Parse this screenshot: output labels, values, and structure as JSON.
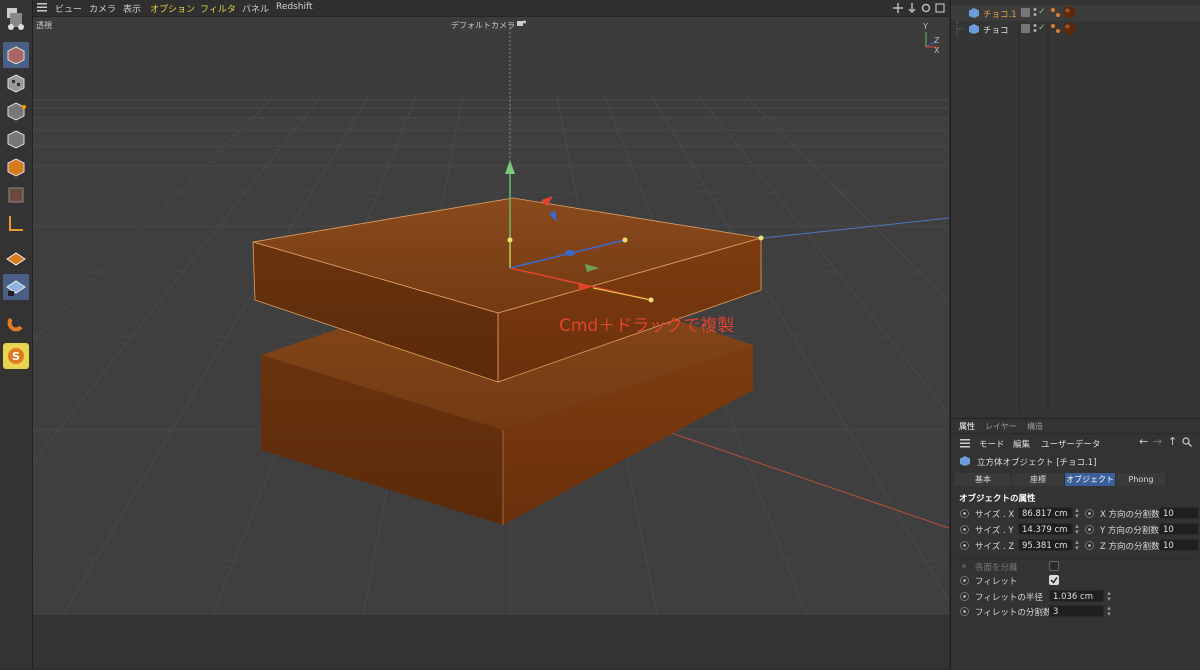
{
  "menubar": {
    "items": [
      "ビュー",
      "カメラ",
      "表示",
      "オプション",
      "フィルタ",
      "パネル",
      "Redshift"
    ]
  },
  "viewport": {
    "view_label": "透視",
    "camera_label": "デフォルトカメラ",
    "annotation": "Cmd＋ドラッグで複製",
    "axis_letters": {
      "y": "Y",
      "z": "Z",
      "x": "X"
    }
  },
  "object_manager": {
    "objects": [
      {
        "name": "チョコ.1",
        "selected": true
      },
      {
        "name": "チョコ",
        "selected": false
      }
    ]
  },
  "attributes": {
    "tabs": [
      "属性",
      "レイヤー",
      "構造"
    ],
    "toolbar": [
      "モード",
      "編集",
      "ユーザーデータ"
    ],
    "object_title": "立方体オブジェクト [チョコ.1]",
    "subtabs": [
      "基本",
      "座標",
      "オブジェクト",
      "Phong"
    ],
    "active_subtab": "オブジェクト",
    "section_title": "オブジェクトの属性",
    "size_rows": [
      {
        "label": "サイズ . X",
        "value": "86.817 cm",
        "seg_label": "X 方向の分割数",
        "seg_value": "10"
      },
      {
        "label": "サイズ . Y",
        "value": "14.379 cm",
        "seg_label": "Y 方向の分割数",
        "seg_value": "10"
      },
      {
        "label": "サイズ . Z",
        "value": "95.381 cm",
        "seg_label": "Z 方向の分割数",
        "seg_value": "10"
      }
    ],
    "separate_faces_label": "各面を分離",
    "fillet_label": "フィレット",
    "fillet_checked": true,
    "fillet_radius_label": "フィレットの半径",
    "fillet_radius_value": "1.036 cm",
    "fillet_subdiv_label": "フィレットの分割数",
    "fillet_subdiv_value": "3"
  },
  "colors": {
    "accent_blue": "#3a5f99",
    "chocolate": "#7a3a10",
    "annotation_red": "#e0452c",
    "menu_highlight": "#e8d44d"
  }
}
